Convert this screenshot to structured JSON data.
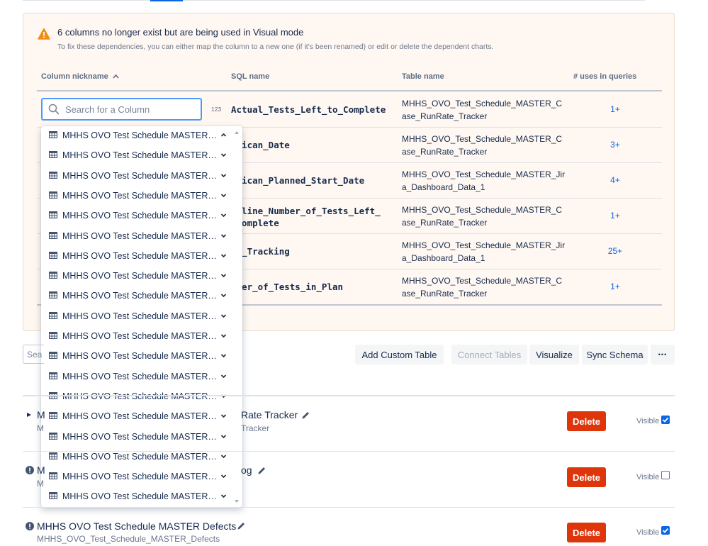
{
  "warning": {
    "title": "6 columns no longer exist but are being used in Visual mode",
    "subtitle": "To fix these dependencies, you can either map the column to a new one (if it's been renamed) or edit or delete the dependent charts."
  },
  "table": {
    "headers": {
      "nickname": "Column nickname",
      "sql": "SQL name",
      "table": "Table name",
      "uses": "# uses in queries"
    },
    "search_placeholder": "Search for a Column",
    "type_badge": "123",
    "rows": [
      {
        "sql": "Actual_Tests_Left_to_Complete",
        "table": "MHHS_OVO_Test_Schedule_MASTER_Case_RunRate_Tracker",
        "uses": "1+"
      },
      {
        "sql": "erican_Date",
        "table": "MHHS_OVO_Test_Schedule_MASTER_Case_RunRate_Tracker",
        "uses": "3+"
      },
      {
        "sql": "erican_Planned_Start_Date",
        "table": "MHHS_OVO_Test_Schedule_MASTER_Jira_Dashboard_Data_1",
        "uses": "4+"
      },
      {
        "sql": "seline_Number_of_Tests_Left_\n_Complete",
        "table": "MHHS_OVO_Test_Schedule_MASTER_Case_RunRate_Tracker",
        "uses": "1+"
      },
      {
        "sql": "se_Tracking",
        "table": "MHHS_OVO_Test_Schedule_MASTER_Jira_Dashboard_Data_1",
        "uses": "25+"
      },
      {
        "sql": "mber_of_Tests_in_Plan",
        "table": "MHHS_OVO_Test_Schedule_MASTER_Case_RunRate_Tracker",
        "uses": "1+"
      }
    ]
  },
  "dropdown": {
    "items": [
      "MHHS OVO Test Schedule MASTER Cas...",
      "MHHS OVO Test Schedule MASTER Cha...",
      "MHHS OVO Test Schedule MASTER Def...",
      "MHHS OVO Test Schedule MASTER Exe...",
      "MHHS OVO Test Schedule MASTER Inv...",
      "MHHS OVO Test Schedule MASTER Jira ...",
      "MHHS OVO Test Schedule MASTER Jira ...",
      "MHHS OVO Test Schedule MASTER Jira ...",
      "MHHS OVO Test Schedule MASTER MA...",
      "MHHS OVO Test Schedule MASTER Rep...",
      "MHHS OVO Test Schedule MASTER Req...",
      "MHHS OVO Test Schedule MASTER Re...",
      "MHHS OVO Test Schedule MASTER She...",
      "MHHS OVO Test Schedule MASTER Test...",
      "MHHS OVO Test Schedule MASTER Test...",
      "MHHS OVO Test Schedule MASTER Test...",
      "MHHS OVO Test Schedule MASTER Test...",
      "MHHS OVO Test Schedule MASTER Test...",
      "MHHS OVO Test Schedule MASTER Tim..."
    ],
    "first_expanded": true
  },
  "toolbar": {
    "search_stub": "Sea",
    "add_custom_table": "Add Custom Table",
    "connect_tables": "Connect Tables",
    "visualize": "Visualize",
    "sync_schema": "Sync Schema",
    "more": "•••"
  },
  "datasets": [
    {
      "title_prefix": "M",
      "title_suffix": "Rate Tracker",
      "sub_prefix": "M",
      "sub_suffix": "Tracker",
      "delete": "Delete",
      "visible_label": "Visible",
      "visible": true,
      "icon": "triangle-right-icon"
    },
    {
      "title_prefix": "M",
      "title_suffix": "og",
      "sub_prefix": "M",
      "sub_suffix": "",
      "delete": "Delete",
      "visible_label": "Visible",
      "visible": false,
      "icon": "info-icon"
    },
    {
      "title": "MHHS OVO Test Schedule MASTER Defects",
      "sub": "MHHS_OVO_Test_Schedule_MASTER_Defects",
      "delete": "Delete",
      "visible_label": "Visible",
      "visible": true,
      "icon": "info-icon"
    }
  ],
  "colors": {
    "accent": "#0c66e4",
    "danger": "#de350b",
    "warning": "#f18d13"
  }
}
